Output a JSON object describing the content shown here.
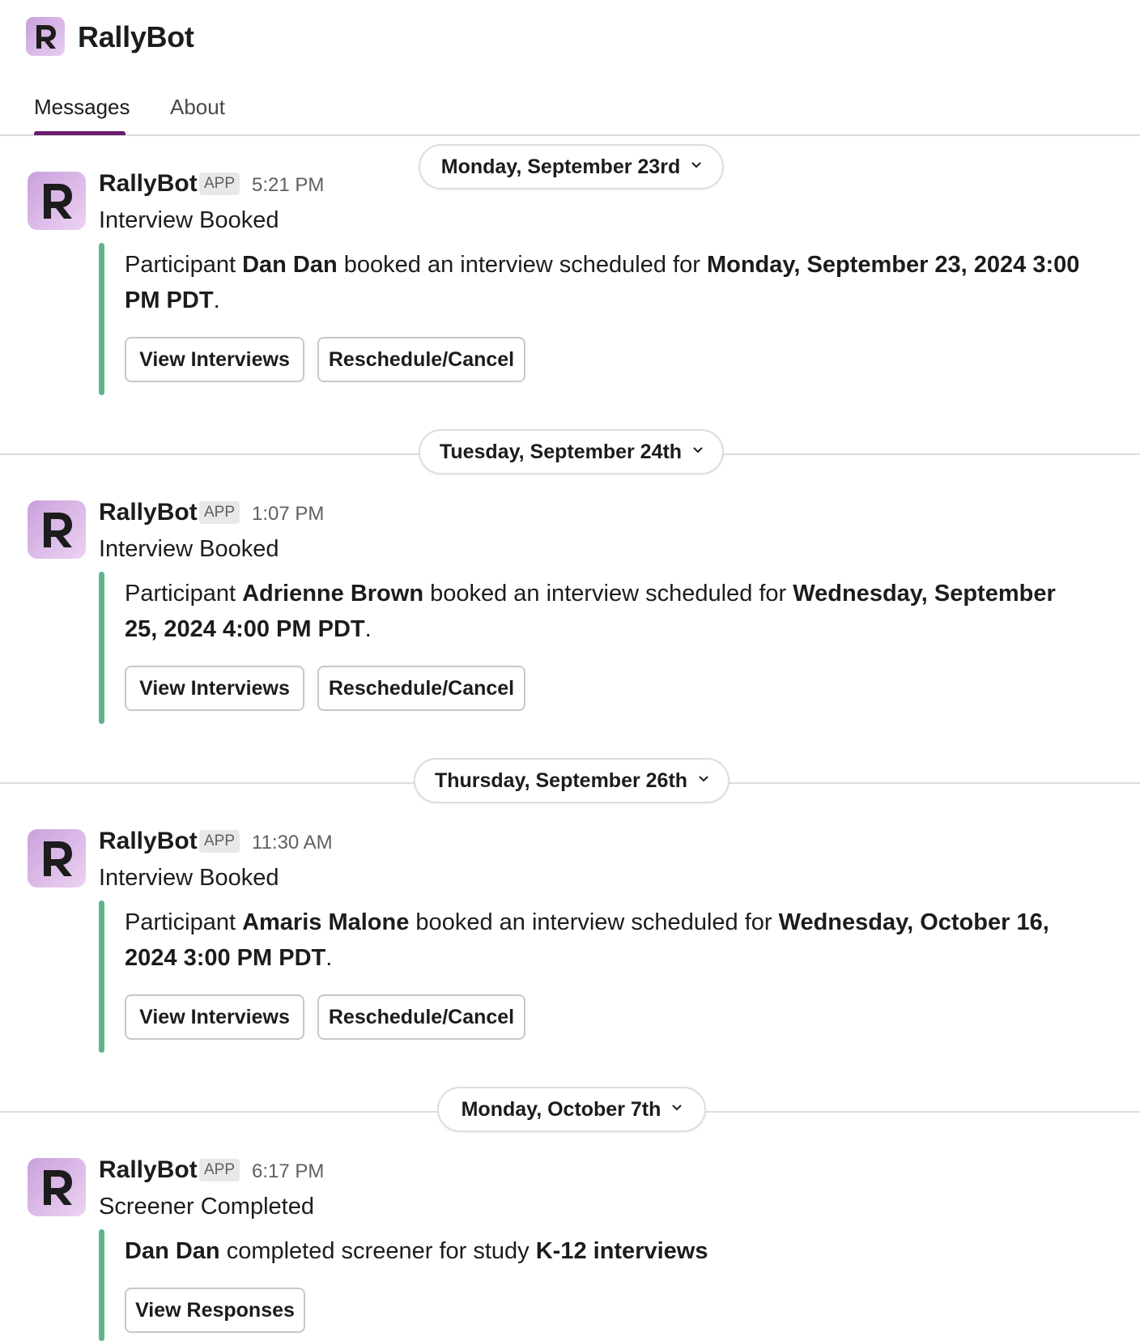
{
  "app": {
    "name": "RallyBot",
    "logo_letter": "R"
  },
  "tabs": [
    {
      "label": "Messages"
    },
    {
      "label": "About"
    }
  ],
  "accent": "#6b1b6f",
  "attachment_color": "#5fb58a",
  "days": [
    {
      "label": "Monday, September 23rd",
      "message": {
        "sender": "RallyBot",
        "badge": "APP",
        "time": "5:21 PM",
        "title": "Interview Booked",
        "segments": [
          {
            "text": "Participant ",
            "bold": false
          },
          {
            "text": "Dan Dan",
            "bold": true
          },
          {
            "text": " booked an interview scheduled for ",
            "bold": false
          },
          {
            "text": "Monday, September 23, 2024 3:00 PM PDT",
            "bold": true
          },
          {
            "text": ".",
            "bold": false
          }
        ],
        "buttons": [
          "View Interviews",
          "Reschedule/Cancel"
        ]
      }
    },
    {
      "label": "Tuesday, September 24th",
      "message": {
        "sender": "RallyBot",
        "badge": "APP",
        "time": "1:07 PM",
        "title": "Interview Booked",
        "segments": [
          {
            "text": "Participant ",
            "bold": false
          },
          {
            "text": "Adrienne Brown",
            "bold": true
          },
          {
            "text": " booked an interview scheduled for ",
            "bold": false
          },
          {
            "text": "Wednesday, September 25, 2024 4:00 PM PDT",
            "bold": true
          },
          {
            "text": ".",
            "bold": false
          }
        ],
        "buttons": [
          "View Interviews",
          "Reschedule/Cancel"
        ]
      }
    },
    {
      "label": "Thursday, September 26th",
      "message": {
        "sender": "RallyBot",
        "badge": "APP",
        "time": "11:30 AM",
        "title": "Interview Booked",
        "segments": [
          {
            "text": "Participant ",
            "bold": false
          },
          {
            "text": "Amaris Malone",
            "bold": true
          },
          {
            "text": " booked an interview scheduled for ",
            "bold": false
          },
          {
            "text": "Wednesday, October 16, 2024 3:00 PM PDT",
            "bold": true
          },
          {
            "text": ".",
            "bold": false
          }
        ],
        "buttons": [
          "View Interviews",
          "Reschedule/Cancel"
        ]
      }
    },
    {
      "label": "Monday, October 7th",
      "message": {
        "sender": "RallyBot",
        "badge": "APP",
        "time": "6:17 PM",
        "title": "Screener Completed",
        "segments": [
          {
            "text": "Dan Dan",
            "bold": true
          },
          {
            "text": " completed screener for study ",
            "bold": false
          },
          {
            "text": "K-12 interviews",
            "bold": true
          }
        ],
        "buttons": [
          "View Responses"
        ]
      }
    }
  ]
}
